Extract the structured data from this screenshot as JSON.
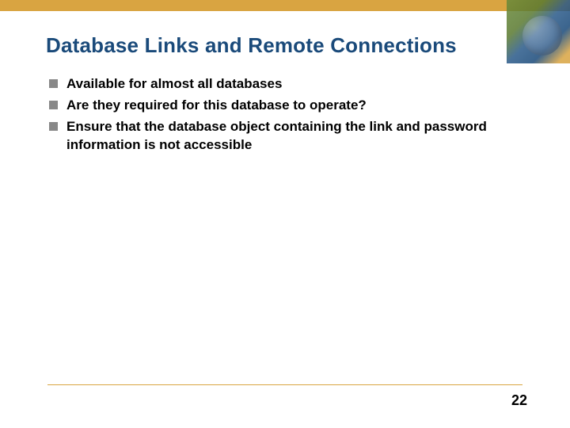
{
  "title": "Database Links and Remote Connections",
  "bullets": [
    "Available for almost all databases",
    "Are they required for this database to operate?",
    "Ensure that the database object containing the link and password information is not accessible"
  ],
  "page_number": "22"
}
